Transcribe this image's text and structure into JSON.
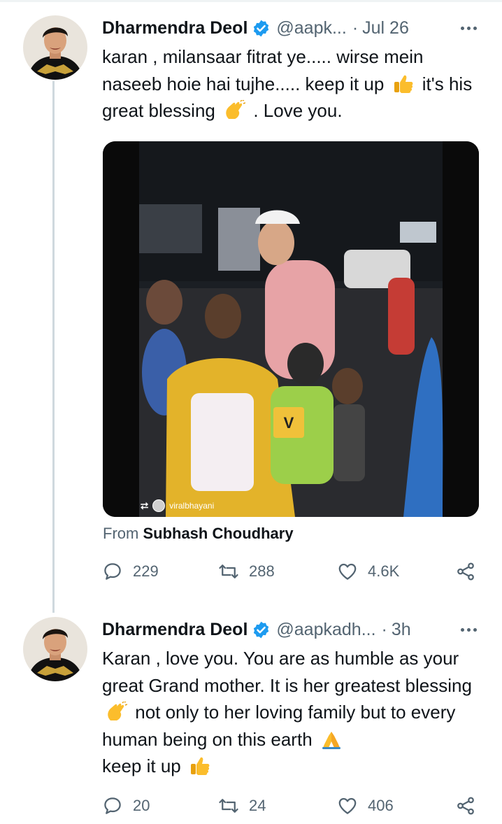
{
  "colors": {
    "text": "#0f1419",
    "secondary": "#536471",
    "verified": "#1d9bf0",
    "thread_line": "#cfd9de"
  },
  "tweets": [
    {
      "name": "Dharmendra Deol",
      "handle": "@aapk...",
      "dot": "·",
      "time": "Jul 26",
      "text_parts": [
        "karan , milansaar fitrat ye..... wirse mein naseeb hoie hai tujhe..... keep it up",
        "it's his great blessing",
        ". Love you."
      ],
      "emojis": [
        "thumbs-up-emoji",
        "clapping-hands-emoji"
      ],
      "media": {
        "credit": "viralbhayani",
        "watermark": "V"
      },
      "from_label": "From",
      "from_name": "Subhash Choudhary",
      "stats": {
        "replies": "229",
        "retweets": "288",
        "likes": "4.6K"
      }
    },
    {
      "name": "Dharmendra Deol",
      "handle": "@aapkadh...",
      "dot": "·",
      "time": "3h",
      "text_parts": [
        "Karan , love you. You are  as humble as your great Grand mother. It is her greatest blessing",
        "not only to her loving family but to every human being on this earth",
        "keep it up"
      ],
      "emojis": [
        "clapping-hands-emoji",
        "folded-hands-emoji",
        "thumbs-up-emoji"
      ],
      "stats": {
        "replies": "20",
        "retweets": "24",
        "likes": "406"
      }
    }
  ]
}
